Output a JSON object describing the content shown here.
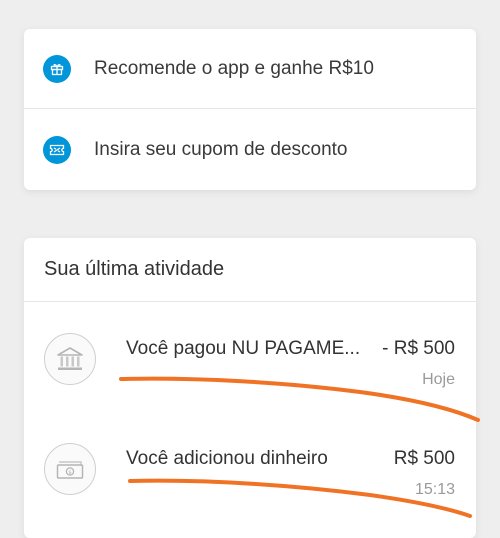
{
  "menu": {
    "items": [
      {
        "label": "Recomende o app e ganhe R$10",
        "icon": "gift-icon"
      },
      {
        "label": "Insira seu cupom de desconto",
        "icon": "ticket-icon"
      }
    ]
  },
  "activity": {
    "title": "Sua última atividade",
    "items": [
      {
        "description": "Você pagou NU PAGAME...",
        "amount": "- R$ 500",
        "time": "Hoje",
        "icon": "bank-icon"
      },
      {
        "description": "Você adicionou dinheiro",
        "amount": "R$ 500",
        "time": "15:13",
        "icon": "money-bill-icon"
      }
    ]
  },
  "colors": {
    "accent": "#0096d9",
    "background": "#eeeeee",
    "annotation": "#f07325"
  }
}
